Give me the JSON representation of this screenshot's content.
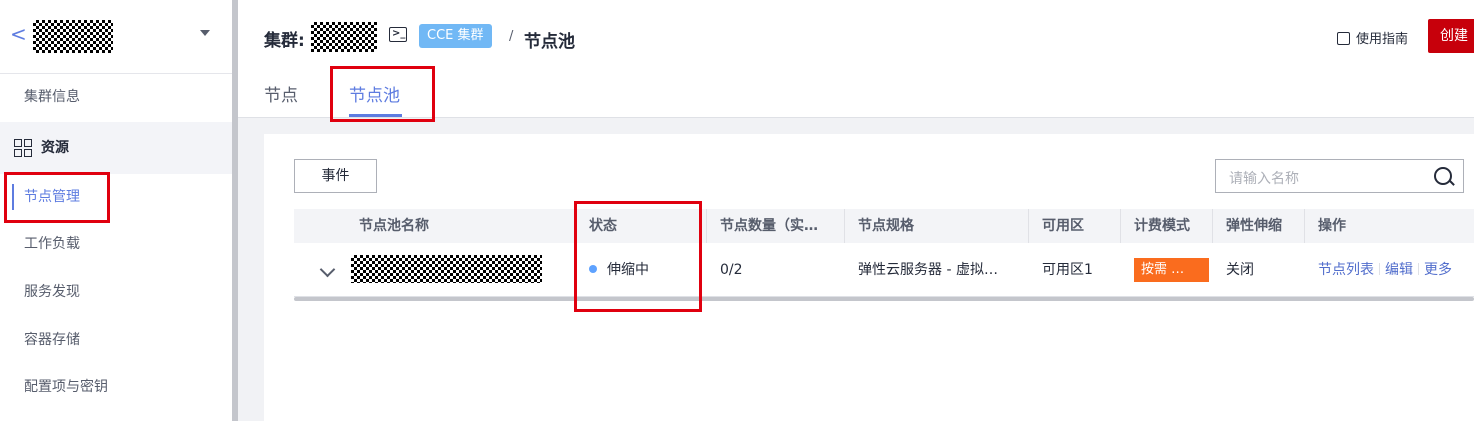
{
  "sidebar": {
    "back_icon": "chevron-left-icon",
    "cluster_info": "集群信息",
    "resources_group": "资源",
    "items": [
      "节点管理",
      "工作负载",
      "服务发现",
      "容器存储",
      "配置项与密钥"
    ]
  },
  "header": {
    "cluster_label": "集群:",
    "terminal_icon": ">_",
    "cce_tag": "CCE 集群",
    "separator": "/",
    "page_title": "节点池",
    "guide_label": "使用指南",
    "create_label": "创建"
  },
  "tabs": [
    {
      "label": "节点"
    },
    {
      "label": "节点池",
      "active": true
    }
  ],
  "toolbar": {
    "event_button": "事件",
    "search_placeholder": "请输入名称"
  },
  "table": {
    "headers": [
      "节点池名称",
      "状态",
      "节点数量（实…",
      "节点规格",
      "可用区",
      "计费模式",
      "弹性伸缩",
      "操作"
    ],
    "rows": [
      {
        "status": "伸缩中",
        "node_count": "0/2",
        "spec": "弹性云服务器 - 虚拟…",
        "zone": "可用区1",
        "billing": "按需 …",
        "autoscaling": "关闭",
        "ops": [
          "节点列表",
          "编辑",
          "更多"
        ]
      }
    ]
  },
  "colors": {
    "accent": "#5e7ce0",
    "create_button": "#c7000b",
    "billing_tag": "#fa6c1e",
    "status_dot": "#5ea2ff",
    "cce_tag": "#71b8f5",
    "highlight_box": "#e0000f"
  }
}
